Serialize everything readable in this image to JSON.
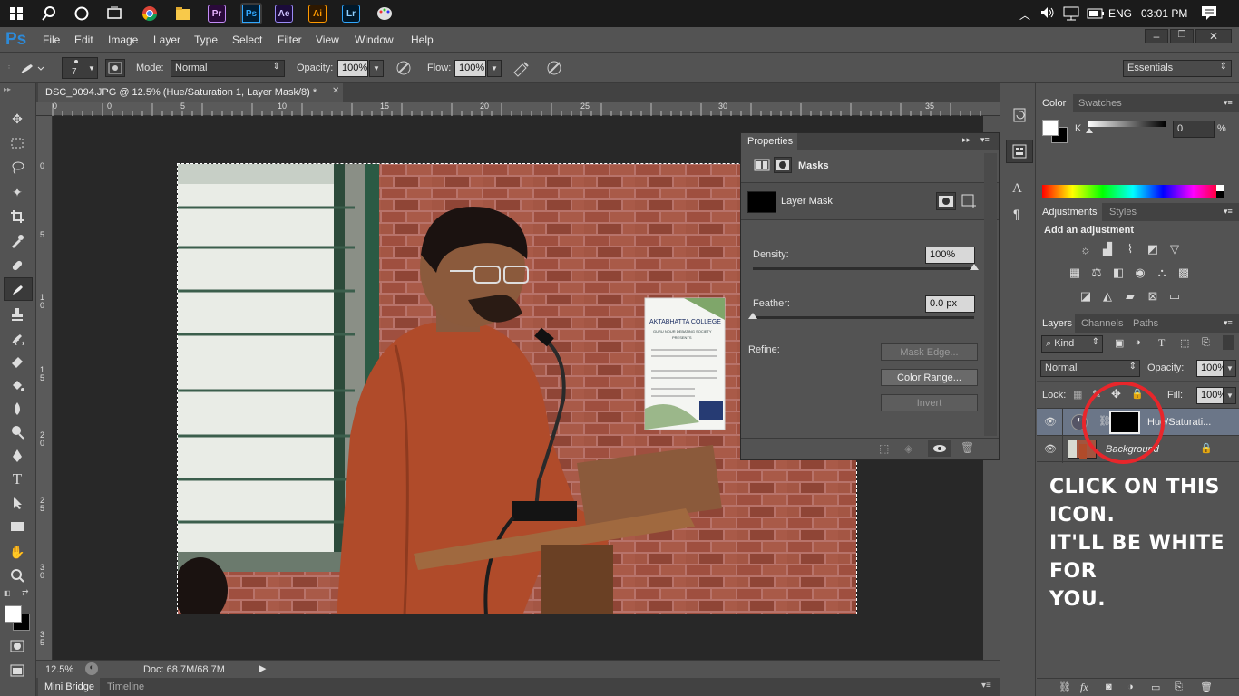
{
  "taskbar": {
    "time": "03:01 PM",
    "lang": "ENG",
    "apps": [
      "Pr",
      "Ps",
      "Ae",
      "Ai",
      "Lr"
    ]
  },
  "app": {
    "logo": "Ps"
  },
  "menu": [
    "File",
    "Edit",
    "Image",
    "Layer",
    "Type",
    "Select",
    "Filter",
    "View",
    "Window",
    "Help"
  ],
  "options": {
    "brush_size": "7",
    "mode_label": "Mode:",
    "mode_value": "Normal",
    "opacity_label": "Opacity:",
    "opacity_value": "100%",
    "flow_label": "Flow:",
    "flow_value": "100%",
    "workspace": "Essentials"
  },
  "document": {
    "tab_title": "DSC_0094.JPG @ 12.5% (Hue/Saturation 1, Layer Mask/8) *",
    "ruler_top": [
      "0",
      "0",
      "5",
      "10",
      "15",
      "20",
      "25",
      "30",
      "35"
    ],
    "ruler_left": [
      "0",
      "5",
      "1 0",
      "1 5",
      "2 0",
      "2 5",
      "3 0",
      "3 5"
    ],
    "zoom": "12.5%",
    "doc_size": "Doc: 68.7M/68.7M"
  },
  "photo": {
    "poster_lines": [
      "AKTABHATTA COLLEGE",
      "GURU NOUR DEBATING SOCIETY",
      "PRESENTS"
    ]
  },
  "bottom_tabs": [
    "Mini Bridge",
    "Timeline"
  ],
  "properties": {
    "title": "Properties",
    "section": "Masks",
    "mask_label": "Layer Mask",
    "density_label": "Density:",
    "density_value": "100%",
    "density": 1.0,
    "feather_label": "Feather:",
    "feather_value": "0.0 px",
    "feather": 0.0,
    "refine_label": "Refine:",
    "mask_edge": "Mask Edge...",
    "color_range": "Color Range...",
    "invert": "Invert"
  },
  "color_panel": {
    "tabs": [
      "Color",
      "Swatches"
    ],
    "channel": "K",
    "value": "0",
    "unit": "%"
  },
  "adjustments_panel": {
    "tabs": [
      "Adjustments",
      "Styles"
    ],
    "heading": "Add an adjustment"
  },
  "layers_panel": {
    "tabs": [
      "Layers",
      "Channels",
      "Paths"
    ],
    "filter": "Kind",
    "blend_mode": "Normal",
    "opacity_label": "Opacity:",
    "opacity_value": "100%",
    "lock_label": "Lock:",
    "fill_label": "Fill:",
    "fill_value": "100%",
    "layers": [
      {
        "name": "Hue/Saturati..."
      },
      {
        "name": "Background"
      }
    ]
  },
  "annotation": {
    "lines": [
      "CLICK ON THIS ICON.",
      "IT'LL BE WHITE FOR",
      "YOU."
    ],
    "color": "#e8262b"
  }
}
